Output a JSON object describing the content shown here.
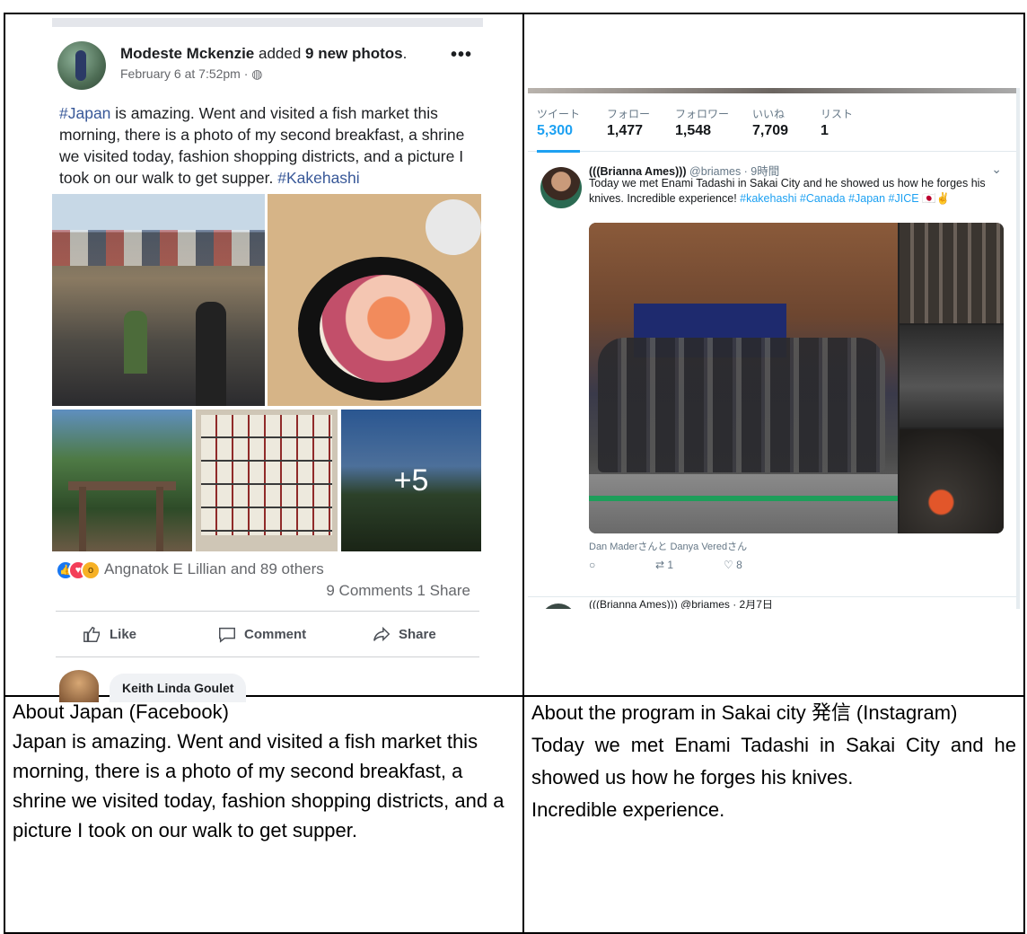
{
  "facebook": {
    "author": "Modeste Mckenzie",
    "action": "added",
    "count_text": "9 new photos",
    "period": ".",
    "more": "•••",
    "date": "February 6 at 7:52pm · ◍",
    "hashtag1": "#Japan",
    "body": " is amazing. Went and visited a fish market this morning, there is a photo of my second breakfast, a shrine we visited today, fashion shopping districts, and a picture I took on our walk to get supper. ",
    "hashtag2": "#Kakehashi",
    "more_photos": "+5",
    "reactions_text": "Angnatok E Lillian and 89 others",
    "counts": "9 Comments  1 Share",
    "like_label": "Like",
    "comment_label": "Comment",
    "share_label": "Share",
    "commenter": "Keith Linda Goulet"
  },
  "twitter": {
    "stats": [
      {
        "label": "ツイート",
        "value": "5,300"
      },
      {
        "label": "フォロー",
        "value": "1,477"
      },
      {
        "label": "フォロワー",
        "value": "1,548"
      },
      {
        "label": "いいね",
        "value": "7,709"
      },
      {
        "label": "リスト",
        "value": "1"
      }
    ],
    "name": "(((Brianna Ames)))",
    "handle_time": " @briames · 9時間",
    "chevron": "⌄",
    "text": "Today we met Enami Tadashi in Sakai City and he showed us how he forges his knives. Incredible experience! ",
    "hashtags": "#kakehashi #Canada #Japan #JICE",
    "emoji": "🇯🇵✌",
    "caption": "Dan Maderさんと Danya Veredさん",
    "reply_icon": "○",
    "retweet": "⇄ 1",
    "like": "♡ 8",
    "next_tweet": "(((Brianna Ames))) @briames · 2月7日"
  },
  "captions": {
    "left_title": "About Japan (Facebook)",
    "left_body": "Japan is amazing. Went and visited a fish market this morning, there is a photo of my second breakfast, a shrine we visited today, fashion shopping districts, and a picture I took on our walk to get supper.",
    "right_title": "About the program in Sakai city 発信 (Instagram)",
    "right_body1": "Today we met Enami Tadashi in Sakai City and he showed us how he forges his knives.",
    "right_body2": "Incredible experience."
  }
}
